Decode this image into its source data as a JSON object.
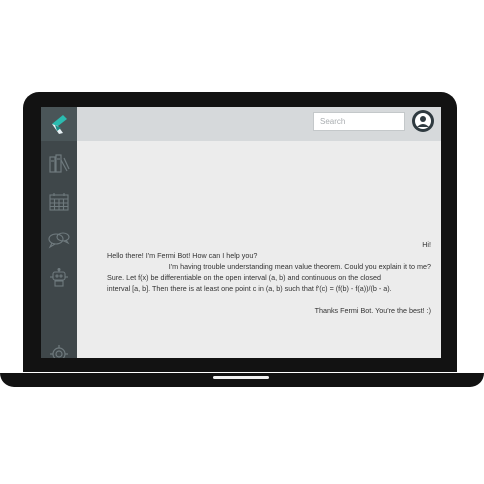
{
  "colors": {
    "sidebar": "#3f474a",
    "topbar": "#d6d9db",
    "chat_bg": "#ececec",
    "logo_teal": "#2bbbb0",
    "logo_light": "#e8f2f5",
    "laptop": "#121212"
  },
  "sidebar": {
    "logo_icon": "fermi-logo",
    "items": [
      {
        "icon": "books-icon"
      },
      {
        "icon": "calendar-icon"
      },
      {
        "icon": "chat-bubbles-icon"
      },
      {
        "icon": "robot-icon"
      },
      {
        "icon": "gear-icon"
      }
    ]
  },
  "header": {
    "search_placeholder": "Search",
    "avatar_icon": "user-avatar-icon"
  },
  "chat": {
    "messages": [
      {
        "sender": "user",
        "text": "Hi!"
      },
      {
        "sender": "bot",
        "text": "Hello there! I'm Fermi Bot! How can I help you?"
      },
      {
        "sender": "user",
        "text": "I'm having trouble understanding mean value theorem. Could you explain it to me?"
      },
      {
        "sender": "bot",
        "text": "Sure. Let f(x) be differentiable on the open interval (a, b) and continuous on the closed interval [a, b]. Then there is at least one point c in (a, b) such that f'(c) = (f(b) - f(a))/(b - a)."
      },
      {
        "sender": "user",
        "text": "Thanks Fermi Bot. You're the best! :)"
      }
    ]
  }
}
